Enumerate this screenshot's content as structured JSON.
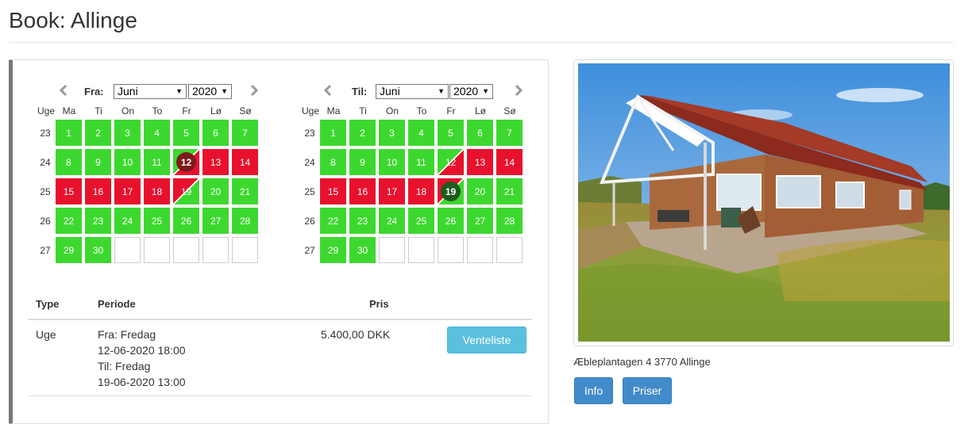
{
  "page": {
    "title": "Book: Allinge"
  },
  "calendar_from": {
    "label": "Fra:",
    "month": "Juni",
    "year": "2020",
    "week_header": "Uge",
    "weekdays": [
      "Ma",
      "Ti",
      "On",
      "To",
      "Fr",
      "Lø",
      "Sø"
    ],
    "weeks": [
      "23",
      "24",
      "25",
      "26",
      "27"
    ],
    "days": [
      [
        "1",
        "2",
        "3",
        "4",
        "5",
        "6",
        "7"
      ],
      [
        "8",
        "9",
        "10",
        "11",
        "12",
        "13",
        "14"
      ],
      [
        "15",
        "16",
        "17",
        "18",
        "19",
        "20",
        "21"
      ],
      [
        "22",
        "23",
        "24",
        "25",
        "26",
        "27",
        "28"
      ],
      [
        "29",
        "30",
        "",
        "",
        "",
        "",
        ""
      ]
    ]
  },
  "calendar_to": {
    "label": "Til:",
    "month": "Juni",
    "year": "2020",
    "week_header": "Uge",
    "weekdays": [
      "Ma",
      "Ti",
      "On",
      "To",
      "Fr",
      "Lø",
      "Sø"
    ],
    "weeks": [
      "23",
      "24",
      "25",
      "26",
      "27"
    ],
    "days": [
      [
        "1",
        "2",
        "3",
        "4",
        "5",
        "6",
        "7"
      ],
      [
        "8",
        "9",
        "10",
        "11",
        "12",
        "13",
        "14"
      ],
      [
        "15",
        "16",
        "17",
        "18",
        "19",
        "20",
        "21"
      ],
      [
        "22",
        "23",
        "24",
        "25",
        "26",
        "27",
        "28"
      ],
      [
        "29",
        "30",
        "",
        "",
        "",
        "",
        ""
      ]
    ]
  },
  "availability": [
    [
      "free",
      "free",
      "free",
      "free",
      "free",
      "free",
      "free"
    ],
    [
      "free",
      "free",
      "free",
      "free",
      "free-busy",
      "busy",
      "busy"
    ],
    [
      "busy",
      "busy",
      "busy",
      "busy",
      "busy-free",
      "free",
      "free"
    ],
    [
      "free",
      "free",
      "free",
      "free",
      "free",
      "free",
      "free"
    ],
    [
      "free",
      "free",
      "empty",
      "empty",
      "empty",
      "empty",
      "empty"
    ]
  ],
  "selection": {
    "from_day": "12",
    "to_day": "19"
  },
  "colors": {
    "free": "#3dd82f",
    "busy": "#e8112d",
    "info_button": "#5bc0de",
    "primary_button": "#428bca"
  },
  "table": {
    "headers": {
      "type": "Type",
      "period": "Periode",
      "price": "Pris"
    },
    "row": {
      "type": "Uge",
      "from_label": "Fra: Fredag",
      "from_datetime": "12-06-2020 18:00",
      "to_label": "Til: Fredag",
      "to_datetime": "19-06-2020 13:00",
      "price": "5.400,00 DKK",
      "button": "Venteliste"
    }
  },
  "property": {
    "address": "Æbleplantagen 4 3770 Allinge",
    "info_button": "Info",
    "prices_button": "Priser"
  }
}
